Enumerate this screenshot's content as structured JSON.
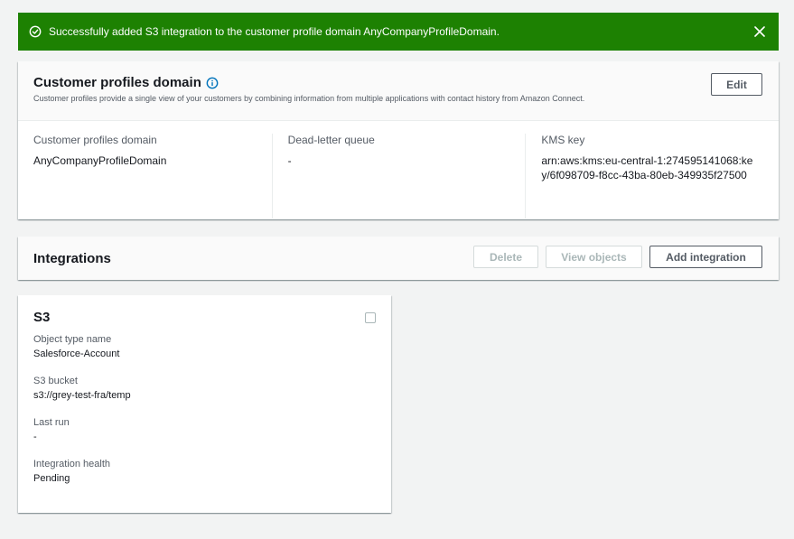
{
  "flash": {
    "message": "Successfully added S3 integration to the customer profile domain AnyCompanyProfileDomain.",
    "icon": "check-circle-icon",
    "close_icon": "close-icon",
    "color": "#1d8102"
  },
  "domain": {
    "title": "Customer profiles domain",
    "description": "Customer profiles provide a single view of your customers by combining information from multiple applications with contact history from Amazon Connect.",
    "edit_label": "Edit",
    "info_icon": "info-icon",
    "columns": [
      {
        "label": "Customer profiles domain",
        "value": "AnyCompanyProfileDomain"
      },
      {
        "label": "Dead-letter queue",
        "value": "-"
      },
      {
        "label": "KMS key",
        "value": "arn:aws:kms:eu-central-1:274595141068:key/6f098709-f8cc-43ba-80eb-349935f27500"
      }
    ]
  },
  "integrations": {
    "title": "Integrations",
    "delete_label": "Delete",
    "view_objects_label": "View objects",
    "add_label": "Add integration"
  },
  "card": {
    "title": "S3",
    "fields": [
      {
        "label": "Object type name",
        "value": "Salesforce-Account"
      },
      {
        "label": "S3 bucket",
        "value": "s3://grey-test-fra/temp"
      },
      {
        "label": "Last run",
        "value": "-"
      },
      {
        "label": "Integration health",
        "value": "Pending"
      }
    ]
  }
}
